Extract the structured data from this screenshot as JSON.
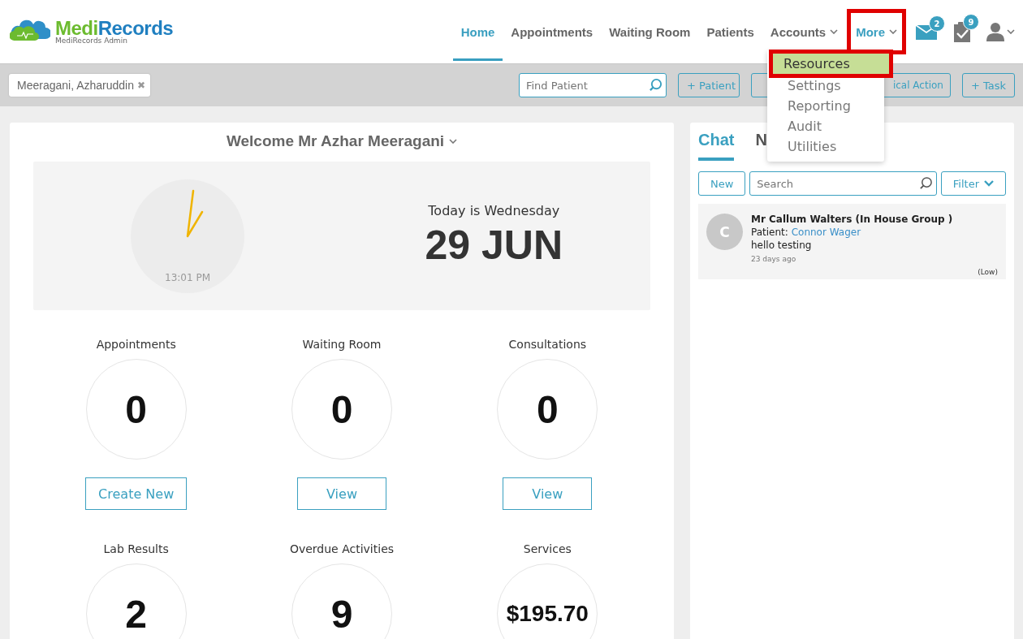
{
  "header": {
    "logo": {
      "brand_part1": "Medi",
      "brand_part2": "Records",
      "subtitle": "MediRecords Admin"
    },
    "nav": [
      {
        "label": "Home",
        "selected": true,
        "caret": false,
        "highlighted": false
      },
      {
        "label": "Appointments",
        "selected": false,
        "caret": false,
        "highlighted": false
      },
      {
        "label": "Waiting Room",
        "selected": false,
        "caret": false,
        "highlighted": false
      },
      {
        "label": "Patients",
        "selected": false,
        "caret": false,
        "highlighted": false
      },
      {
        "label": "Accounts",
        "selected": false,
        "caret": true,
        "highlighted": false
      },
      {
        "label": "More",
        "selected": false,
        "caret": true,
        "highlighted": true
      }
    ],
    "icons": [
      {
        "kind": "mail",
        "badge": "2"
      },
      {
        "kind": "tasks",
        "badge": "9"
      },
      {
        "kind": "user"
      }
    ]
  },
  "more_menu": [
    {
      "label": "Resources",
      "selected": true,
      "highlighted": true
    },
    {
      "label": "Settings",
      "selected": false,
      "highlighted": false
    },
    {
      "label": "Reporting",
      "selected": false,
      "highlighted": false
    },
    {
      "label": "Audit",
      "selected": false,
      "highlighted": false
    },
    {
      "label": "Utilities",
      "selected": false,
      "highlighted": false
    }
  ],
  "toolbar": {
    "patient_tab": "Meeragani, Azharuddin",
    "close": "✖",
    "find_placeholder": "Find Patient",
    "buttons": [
      {
        "kind": "button",
        "label": "+ Patient"
      },
      {
        "kind": "covered"
      },
      {
        "kind": "button",
        "label": "ical Action"
      },
      {
        "kind": "button",
        "label": "+ Task"
      }
    ]
  },
  "welcome": {
    "title": "Welcome Mr Azhar Meeragani",
    "clock_time": "13:01 PM",
    "day": "Today is Wednesday",
    "date": "29 JUN"
  },
  "stats": [
    {
      "label": "Appointments",
      "value": "0",
      "action": "Create New"
    },
    {
      "label": "Waiting Room",
      "value": "0",
      "action": "View"
    },
    {
      "label": "Consultations",
      "value": "0",
      "action": "View"
    },
    {
      "label": "Lab Results",
      "value": "2"
    },
    {
      "label": "Overdue Activities",
      "value": "9"
    },
    {
      "label": "Services",
      "value": "$195.70"
    }
  ],
  "chat": {
    "tabs": [
      {
        "label": "Chat",
        "selected": true
      },
      {
        "label": "N",
        "selected": false
      }
    ],
    "new_button": "New",
    "search_placeholder": "Search",
    "filter_button": "Filter",
    "messages": [
      {
        "avatar": "C",
        "sender": "Mr Callum Walters (In House Group )",
        "patient_label": "Patient:",
        "patient": "Connor Wager",
        "text": "hello testing",
        "time": "23 days ago",
        "priority": "(Low)"
      }
    ]
  }
}
